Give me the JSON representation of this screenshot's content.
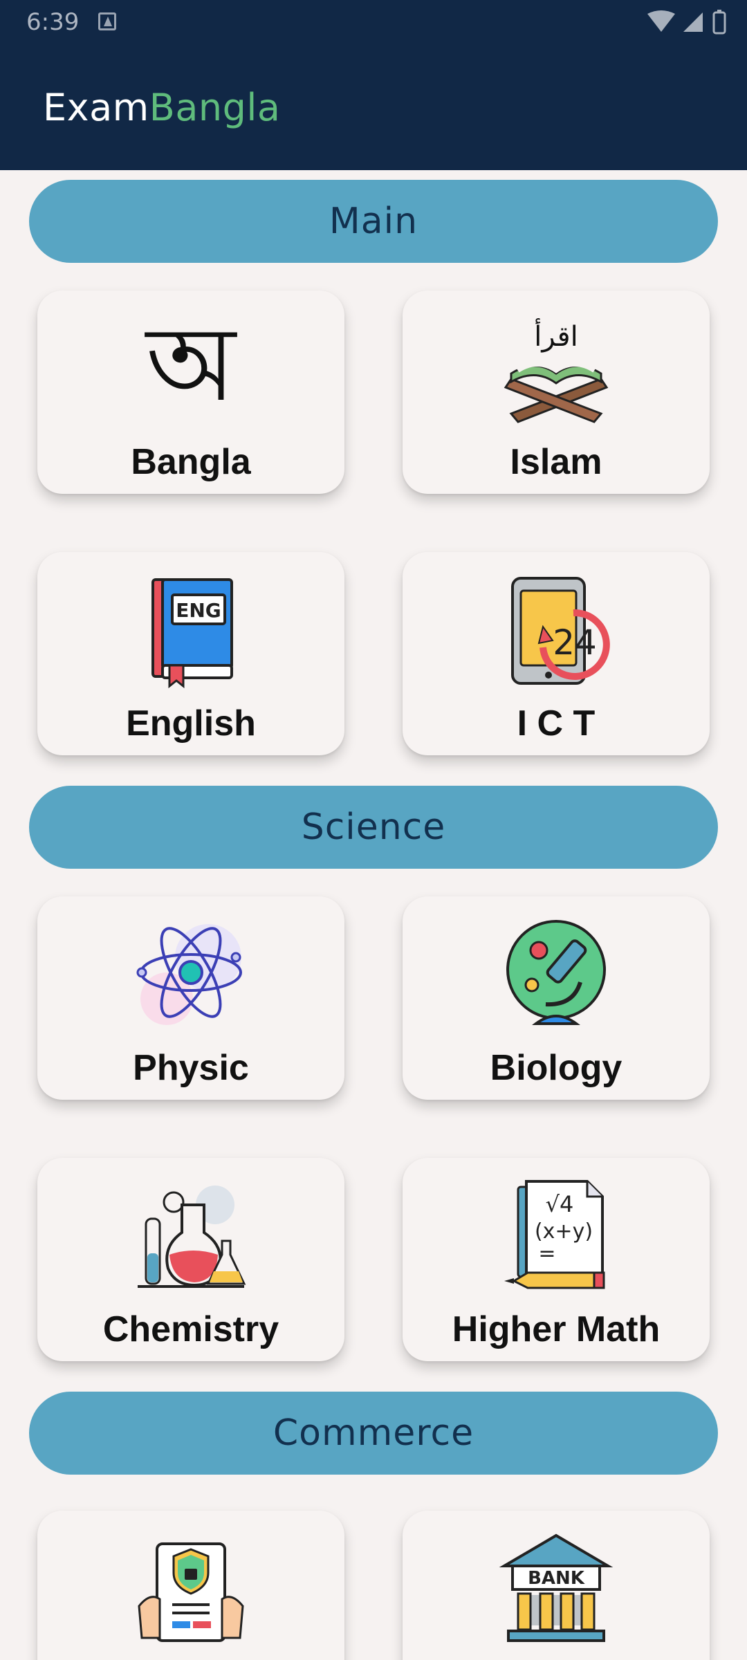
{
  "status_bar": {
    "time": "6:39"
  },
  "app_bar": {
    "title_part1": "Exam",
    "title_part2": "Bangla"
  },
  "sections": {
    "main": "Main",
    "science": "Science",
    "commerce": "Commerce"
  },
  "cards": {
    "bangla": "Bangla",
    "islam": "Islam",
    "english": "English",
    "ict": "I C T",
    "physic": "Physic",
    "biology": "Biology",
    "chemistry": "Chemistry",
    "higher_math": "Higher Math"
  },
  "icon_text": {
    "bangla_glyph": "অ",
    "islam_arabic": "اقرأ",
    "eng_badge": "ENG",
    "ict_24": "24",
    "math_line1": "√4",
    "math_line2": "(x+y)",
    "math_line3": "=",
    "bank": "BANK"
  },
  "colors": {
    "app_bar": "#112846",
    "brand_green": "#5FBC7C",
    "section_pill": "#58A5C3",
    "background": "#F6F2F1"
  }
}
